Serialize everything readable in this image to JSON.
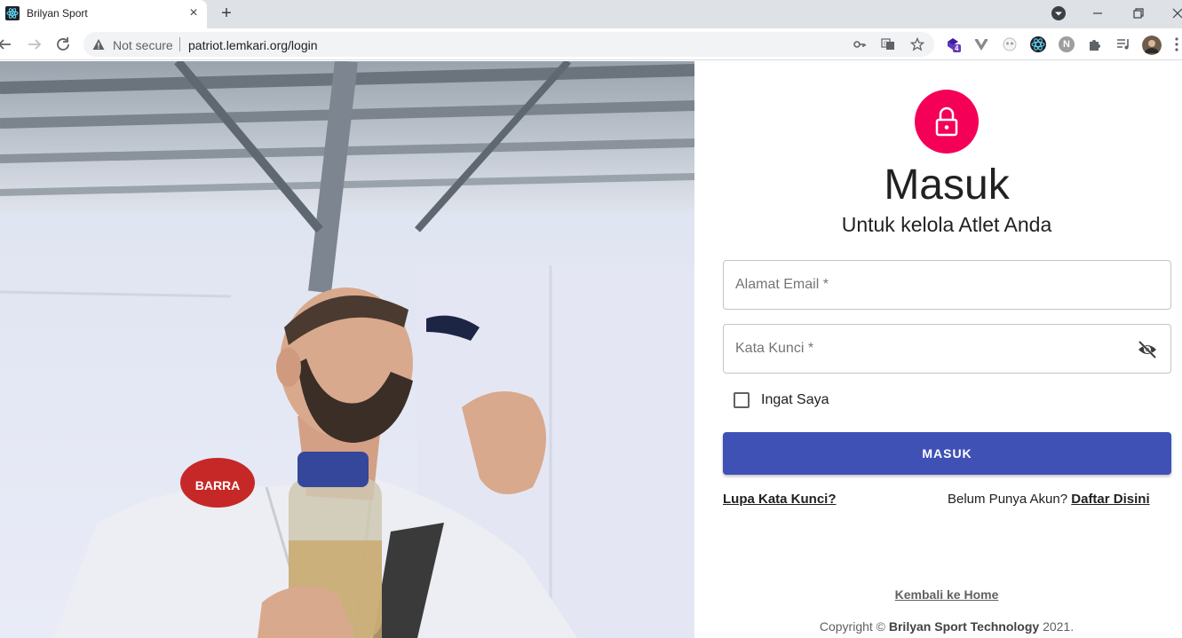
{
  "browser": {
    "tab_title": "Brilyan Sport",
    "tab_close_label": "×",
    "new_tab_label": "+",
    "security_label": "Not secure",
    "url": "patriot.lemkari.org/login",
    "extension_badge": "4",
    "extension_letter": "N"
  },
  "login": {
    "heading": "Masuk",
    "subheading": "Untuk kelola Atlet Anda",
    "email_placeholder": "Alamat Email *",
    "password_placeholder": "Kata Kunci *",
    "remember_label": "Ingat Saya",
    "submit_label": "MASUK",
    "forgot_label": "Lupa Kata Kunci?",
    "signup_prompt": "Belum Punya Akun?",
    "signup_link": "Daftar Disini",
    "back_home_label": "Kembali ke Home",
    "copyright_prefix": "Copyright ©",
    "copyright_company": "Brilyan Sport Technology",
    "copyright_year": "2021."
  },
  "colors": {
    "avatar": "#f50057",
    "primary_button": "#3f51b5"
  }
}
